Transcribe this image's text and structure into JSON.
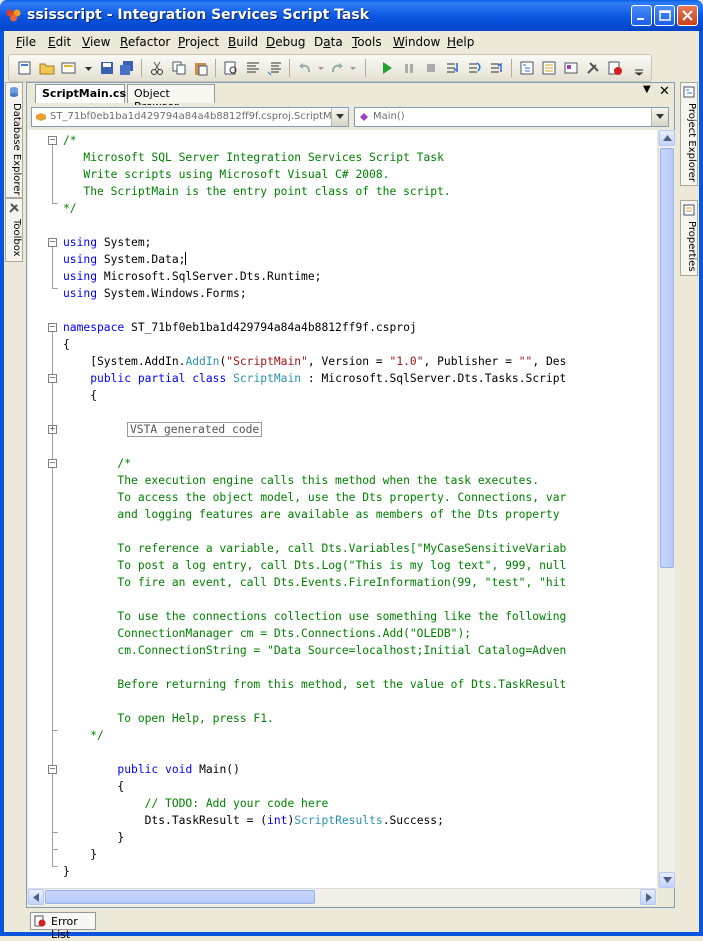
{
  "window": {
    "title": "ssisscript - Integration Services Script Task"
  },
  "menubar": {
    "items": [
      {
        "label": "File",
        "mnemonic": "F"
      },
      {
        "label": "Edit",
        "mnemonic": "E"
      },
      {
        "label": "View",
        "mnemonic": "V"
      },
      {
        "label": "Refactor",
        "mnemonic": "R"
      },
      {
        "label": "Project",
        "mnemonic": "P"
      },
      {
        "label": "Build",
        "mnemonic": "B"
      },
      {
        "label": "Debug",
        "mnemonic": "D"
      },
      {
        "label": "Data",
        "mnemonic": "a"
      },
      {
        "label": "Tools",
        "mnemonic": "T"
      },
      {
        "label": "Window",
        "mnemonic": "W"
      },
      {
        "label": "Help",
        "mnemonic": "H"
      }
    ]
  },
  "tabs": {
    "active": "ScriptMain.cs",
    "other": "Object Browser"
  },
  "navbar": {
    "type_combo": "ST_71bf0eb1ba1d429794a84a4b8812ff9f.csproj.ScriptMa",
    "member_combo": "Main()"
  },
  "left_sidebar": {
    "tabs": [
      "Database Explorer",
      "Toolbox"
    ]
  },
  "right_sidebar": {
    "tabs": [
      "Project Explorer",
      "Properties"
    ]
  },
  "code": {
    "header_comment_open": "/*",
    "header_1": "   Microsoft SQL Server Integration Services Script Task",
    "header_2": "   Write scripts using Microsoft Visual C# 2008.",
    "header_3": "   The ScriptMain is the entry point class of the script.",
    "header_comment_close": "*/",
    "using_kw": "using",
    "using_1": " System;",
    "using_2": " System.Data;",
    "using_3": " Microsoft.SqlServer.Dts.Runtime;",
    "using_4": " System.Windows.Forms;",
    "namespace_kw": "namespace",
    "namespace_name": " ST_71bf0eb1ba1d429794a84a4b8812ff9f.csproj",
    "open_brace": "{",
    "attr_prefix": "    [System.AddIn.",
    "attr_type": "AddIn",
    "attr_open": "(",
    "attr_str1": "\"ScriptMain\"",
    "attr_mid1": ", Version = ",
    "attr_str2": "\"1.0\"",
    "attr_mid2": ", Publisher = ",
    "attr_str3": "\"\"",
    "attr_tail": ", Des",
    "class_indent": "    ",
    "class_kw": "public partial class",
    "class_name": "ScriptMain",
    "class_tail": " : Microsoft.SqlServer.Dts.Tasks.Script",
    "class_brace": "    {",
    "region_label": "VSTA generated code",
    "c_open": "        /*",
    "c1": "        The execution engine calls this method when the task executes.",
    "c2": "        To access the object model, use the Dts property. Connections, var",
    "c3": "        and logging features are available as members of the Dts property",
    "c4": "        To reference a variable, call Dts.Variables[\"MyCaseSensitiveVariab",
    "c5": "        To post a log entry, call Dts.Log(\"This is my log text\", 999, null",
    "c6": "        To fire an event, call Dts.Events.FireInformation(99, \"test\", \"hit",
    "c7": "        To use the connections collection use something like the following",
    "c8": "        ConnectionManager cm = Dts.Connections.Add(\"OLEDB\");",
    "c9": "        cm.ConnectionString = \"Data Source=localhost;Initial Catalog=Adven",
    "c10": "        Before returning from this method, set the value of Dts.TaskResult",
    "c11": "        To open Help, press F1.",
    "c_close": "    */",
    "main_indent": "        ",
    "main_kw1": "public",
    "main_kw2": "void",
    "main_sig": " Main()",
    "main_open": "        {",
    "todo": "            // TODO: Add your code here",
    "result_prefix": "            Dts.TaskResult = (",
    "result_kw": "int",
    "result_mid": ")",
    "result_type": "ScriptResults",
    "result_tail": ".Success;",
    "main_close": "        }",
    "class_close": "    }",
    "ns_close": "}"
  },
  "bottom_panel": {
    "tab": "Error List"
  },
  "colors": {
    "keyword": "#0000ff",
    "comment": "#008000",
    "type": "#2b91af",
    "string": "#a31515",
    "titlebar": "#0a55e0"
  }
}
